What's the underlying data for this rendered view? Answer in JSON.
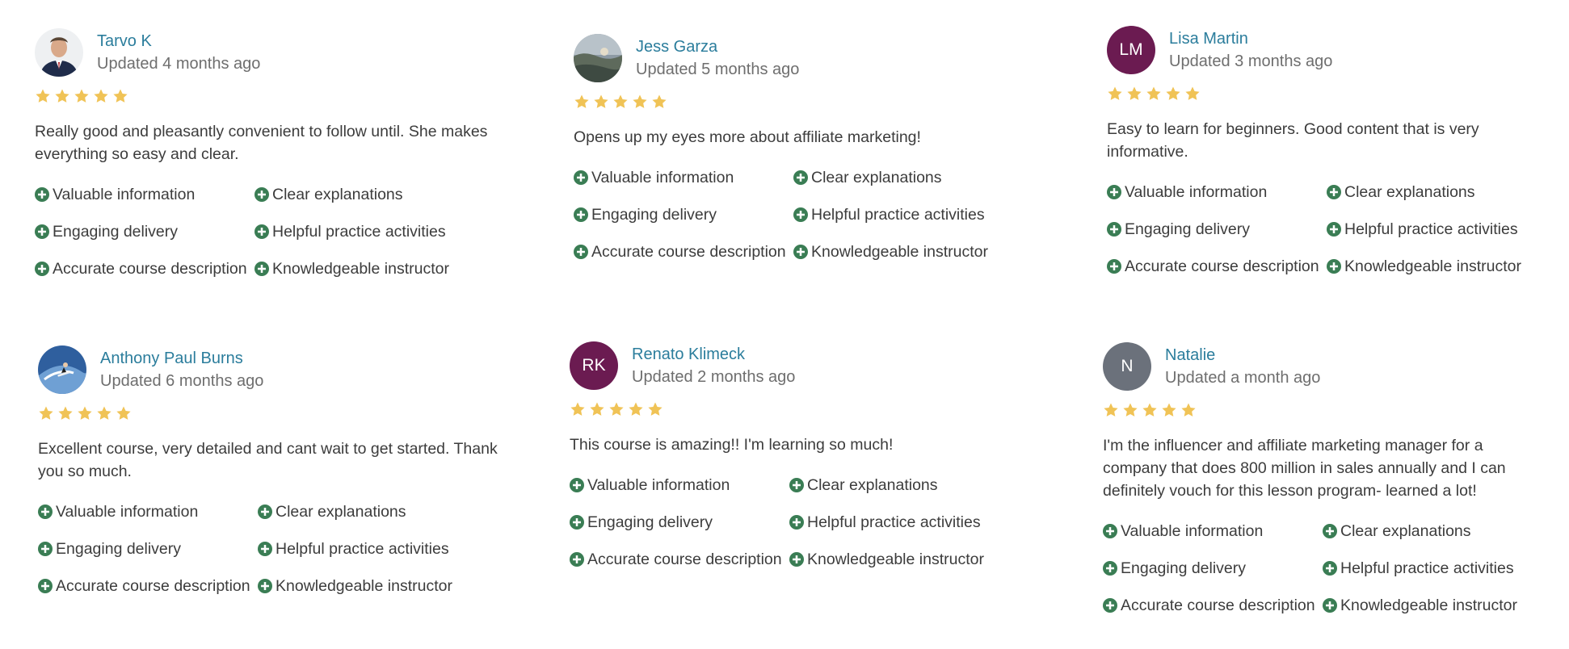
{
  "colors": {
    "star": "#f0c356",
    "tag_icon": "#3a7d54",
    "name_link": "#2b7d9c",
    "avatar_purple": "#6b1b51",
    "avatar_gray": "#6b717b"
  },
  "reviews": [
    {
      "name": "Tarvo K",
      "updated": "Updated 4 months ago",
      "avatar": {
        "type": "photo",
        "icon": "person-photo"
      },
      "rating": 5,
      "comment": "Really good and pleasantly convenient to follow until. She makes everything so easy and clear.",
      "tags": [
        "Valuable information",
        "Clear explanations",
        "Engaging delivery",
        "Helpful practice activities",
        "Accurate course description",
        "Knowledgeable instructor"
      ]
    },
    {
      "name": "Jess Garza",
      "updated": "Updated 5 months ago",
      "avatar": {
        "type": "photo",
        "icon": "landscape-photo"
      },
      "rating": 5,
      "comment": "Opens up my eyes more about affiliate marketing!",
      "tags": [
        "Valuable information",
        "Clear explanations",
        "Engaging delivery",
        "Helpful practice activities",
        "Accurate course description",
        "Knowledgeable instructor"
      ]
    },
    {
      "name": "Lisa Martin",
      "updated": "Updated 3 months ago",
      "avatar": {
        "type": "initials",
        "initials": "LM",
        "color": "#6b1b51"
      },
      "rating": 5,
      "comment": "Easy to learn for beginners. Good content that is very informative.",
      "tags": [
        "Valuable information",
        "Clear explanations",
        "Engaging delivery",
        "Helpful practice activities",
        "Accurate course description",
        "Knowledgeable instructor"
      ]
    },
    {
      "name": "Anthony Paul Burns",
      "updated": "Updated 6 months ago",
      "avatar": {
        "type": "photo",
        "icon": "surfer-photo"
      },
      "rating": 5,
      "comment": "Excellent course, very detailed and cant wait to get started. Thank you so much.",
      "tags": [
        "Valuable information",
        "Clear explanations",
        "Engaging delivery",
        "Helpful practice activities",
        "Accurate course description",
        "Knowledgeable instructor"
      ]
    },
    {
      "name": "Renato Klimeck",
      "updated": "Updated 2 months ago",
      "avatar": {
        "type": "initials",
        "initials": "RK",
        "color": "#6b1b51"
      },
      "rating": 5,
      "comment": "This course is amazing!! I'm learning so much!",
      "tags": [
        "Valuable information",
        "Clear explanations",
        "Engaging delivery",
        "Helpful practice activities",
        "Accurate course description",
        "Knowledgeable instructor"
      ]
    },
    {
      "name": "Natalie",
      "updated": "Updated a month ago",
      "avatar": {
        "type": "initials",
        "initials": "N",
        "color": "#6b717b"
      },
      "rating": 5,
      "comment": "I'm the influencer and affiliate marketing manager for a company that does 800 million in sales annually and I can definitely vouch for this lesson program- learned a lot!",
      "tags": [
        "Valuable information",
        "Clear explanations",
        "Engaging delivery",
        "Helpful practice activities",
        "Accurate course description",
        "Knowledgeable instructor"
      ]
    }
  ]
}
